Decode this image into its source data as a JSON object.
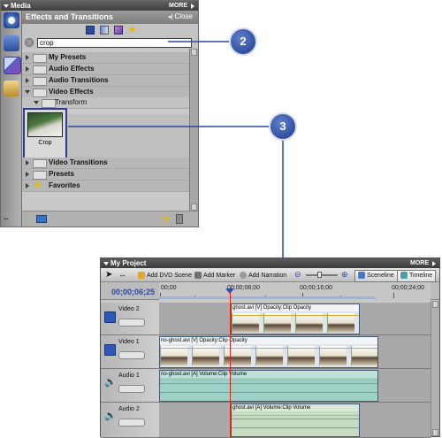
{
  "media_panel": {
    "title": "Media",
    "more": "MORE",
    "effects": {
      "title": "Effects and Transitions",
      "close": "Close",
      "search_value": "crop",
      "tree": [
        {
          "label": "My Presets",
          "expanded": false
        },
        {
          "label": "Audio Effects",
          "expanded": false
        },
        {
          "label": "Audio Transitions",
          "expanded": false
        },
        {
          "label": "Video Effects",
          "expanded": true
        },
        {
          "label": "Transform",
          "expanded": true,
          "child": true
        },
        {
          "label": "Video Transitions",
          "expanded": false
        },
        {
          "label": "Presets",
          "expanded": false
        },
        {
          "label": "Favorites",
          "expanded": false
        }
      ],
      "result_item": "Crop"
    }
  },
  "callouts": [
    "2",
    "3"
  ],
  "project_panel": {
    "title": "My Project",
    "more": "MORE",
    "toolbar": {
      "add_dvd_scene": "Add DVD Scene",
      "add_marker": "Add Marker",
      "add_narration": "Add Narration",
      "sceneline": "Sceneline",
      "timeline": "Timeline"
    },
    "timecode": "00;00;06;25",
    "ruler": [
      "00;00",
      "00;00;08;00",
      "00;00;16;00",
      "00;00;24;00"
    ],
    "tracks": [
      {
        "name": "Video 2",
        "clip": "ghost.avi [V] Opacity:Clip Opacity"
      },
      {
        "name": "Video 1",
        "clip": "no-ghost.avi [V] Opacity:Clip Opacity"
      },
      {
        "name": "Audio 1",
        "clip": "no-ghost.avi [A] Volume:Clip Volume"
      },
      {
        "name": "Audio 2",
        "clip": "ghost.avi [A] Volume:Clip Volume"
      }
    ]
  },
  "colors": {
    "accent": "#2c48a6",
    "playhead": "#d22222",
    "audio_clip": "#9fd0c6"
  }
}
